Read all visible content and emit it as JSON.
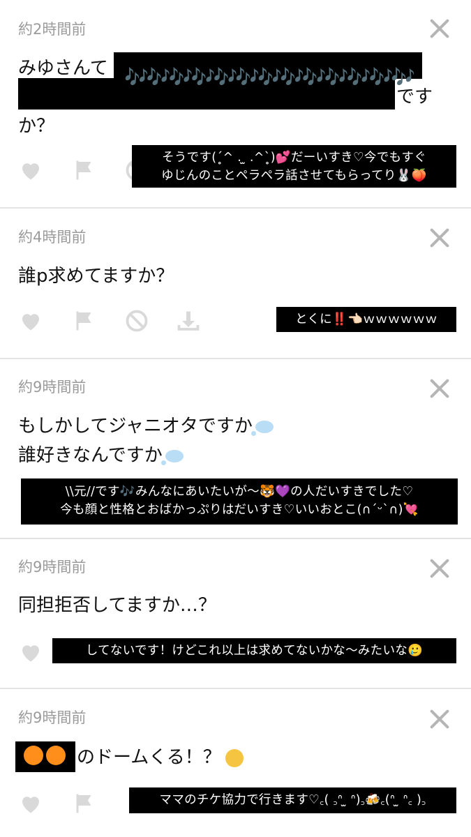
{
  "posts": [
    {
      "time": "約2時間前",
      "question_lead": "みゆさんて",
      "question_tail": "です",
      "question_line3": "か？",
      "notes": "🎶🎶🎶🎶🎶🎶🎶🎶🎶🎶🎶🎶🎶",
      "answer_lines": [
        "そうです(ˊ̥^ . ̫ .^ˋ̥)💕だーいすき♡今でもすぐ",
        "ゆじんのことペラペラ話させてもらってり🐰🍑"
      ]
    },
    {
      "time": "約4時間前",
      "question": "誰p求めてますか？",
      "answer_lines": [
        "とくに‼️👈🏻ｗｗｗｗｗｗ"
      ]
    },
    {
      "time": "約9時間前",
      "question_lines": [
        "もしかしてジャニオタですか",
        "誰好きなんですか"
      ],
      "answer_lines": [
        "\\\\元//です🎶みんなにあいたいが〜🐯💜の人だいすきでした♡",
        "今も顔と性格とおばかっぷりはだいすき♡いいおとこ(∩ˊᵕˋ∩)💘"
      ]
    },
    {
      "time": "約9時間前",
      "question": "同担拒否してますか…？",
      "answer_lines": [
        "してないです！けどこれ以上は求めてないかな〜みたいな🥲"
      ]
    },
    {
      "time": "約9時間前",
      "question": "のドームくる！？",
      "answer_lines": [
        "ママのチケ協力で行きます♡꜀( ꜆ᐢ ̫ ᐢ)꜆🍻꜀(ᐢ ̫ ᐢ꜀ )꜆"
      ]
    }
  ]
}
